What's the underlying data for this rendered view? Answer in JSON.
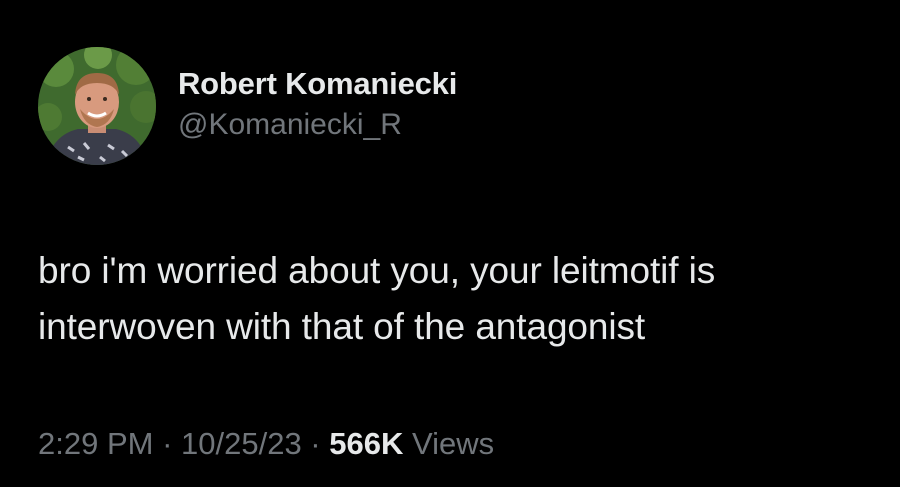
{
  "author": {
    "display_name": "Robert Komaniecki",
    "handle": "@Komaniecki_R"
  },
  "tweet": {
    "text": "bro i'm worried about you, your leitmotif is interwoven with that of the antagonist"
  },
  "meta": {
    "time": "2:29 PM",
    "separator": " · ",
    "date": "10/25/23",
    "views_count": "566K",
    "views_label": " Views"
  },
  "colors": {
    "background": "#000000",
    "primary_text": "#e7e9ea",
    "secondary_text": "#71767b"
  }
}
